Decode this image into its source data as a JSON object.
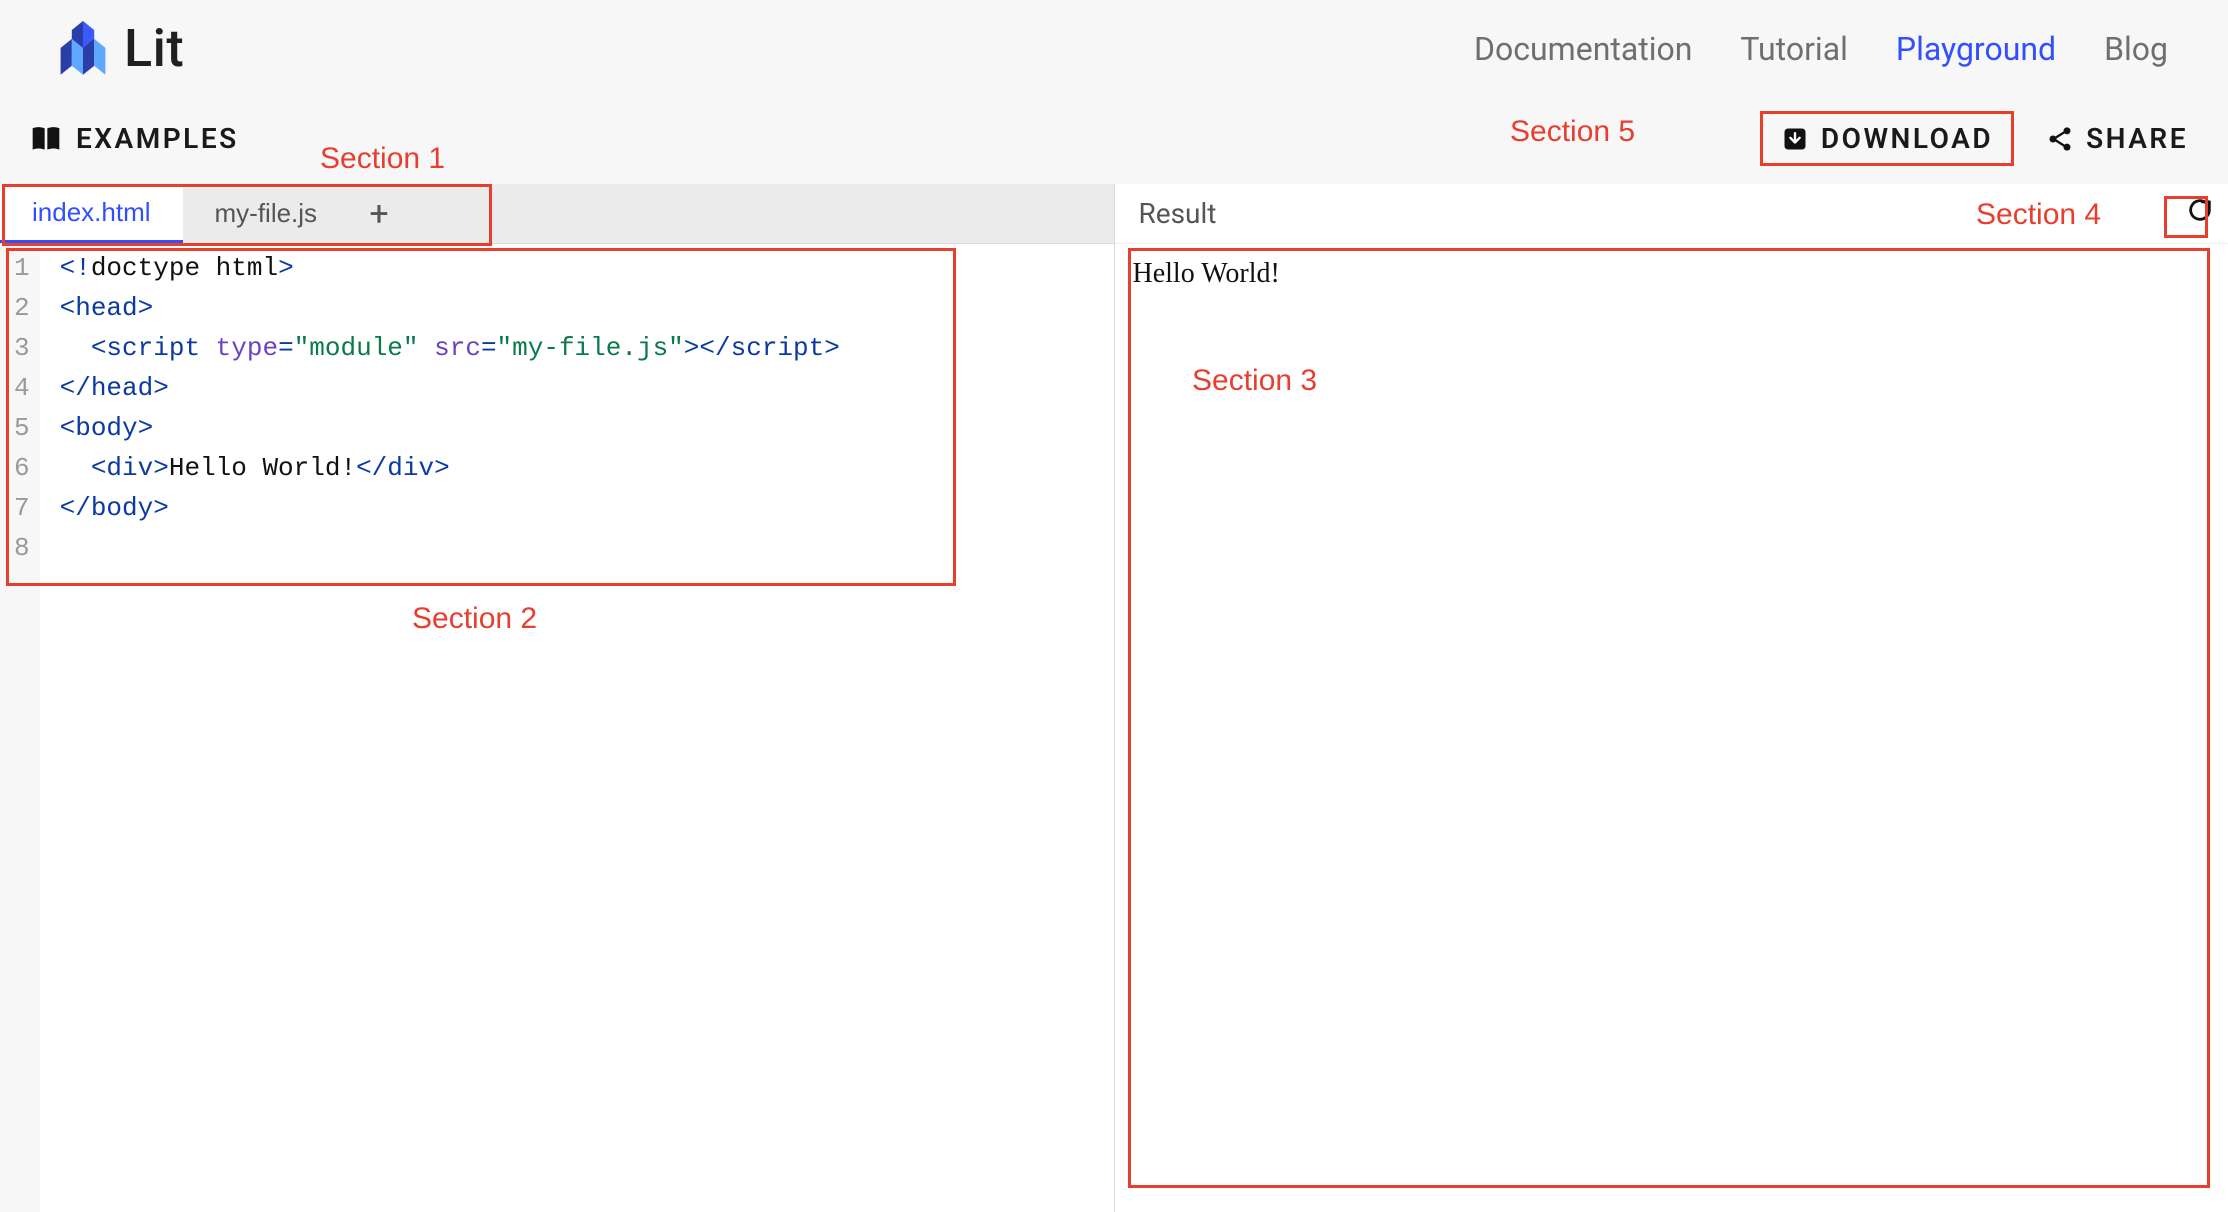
{
  "brand": {
    "name": "Lit"
  },
  "nav": {
    "items": [
      {
        "label": "Documentation",
        "active": false
      },
      {
        "label": "Tutorial",
        "active": false
      },
      {
        "label": "Playground",
        "active": true
      },
      {
        "label": "Blog",
        "active": false
      }
    ]
  },
  "toolbar": {
    "examples_label": "EXAMPLES",
    "download_label": "DOWNLOAD",
    "share_label": "SHARE"
  },
  "annotations": {
    "section1": "Section 1",
    "section2": "Section 2",
    "section3": "Section 3",
    "section4": "Section 4",
    "section5": "Section 5"
  },
  "editor": {
    "tabs": [
      {
        "label": "index.html",
        "active": true
      },
      {
        "label": "my-file.js",
        "active": false
      }
    ],
    "add_tab_glyph": "+",
    "line_count": 8,
    "code_lines": [
      {
        "n": 1,
        "tokens": [
          {
            "t": "<!",
            "c": "tag"
          },
          {
            "t": "doctype html",
            "c": "doctype"
          },
          {
            "t": ">",
            "c": "tag"
          }
        ]
      },
      {
        "n": 2,
        "tokens": [
          {
            "t": "<head>",
            "c": "tag"
          }
        ]
      },
      {
        "n": 3,
        "tokens": [
          {
            "t": "  ",
            "c": "txt"
          },
          {
            "t": "<script ",
            "c": "tag"
          },
          {
            "t": "type",
            "c": "attr"
          },
          {
            "t": "=",
            "c": "tag"
          },
          {
            "t": "\"module\"",
            "c": "str"
          },
          {
            "t": " ",
            "c": "txt"
          },
          {
            "t": "src",
            "c": "attr"
          },
          {
            "t": "=",
            "c": "tag"
          },
          {
            "t": "\"my-file.js\"",
            "c": "str"
          },
          {
            "t": ">",
            "c": "tag"
          },
          {
            "t": "</",
            "c": "tag"
          },
          {
            "t": "script",
            "c": "tag"
          },
          {
            "t": ">",
            "c": "tag"
          }
        ]
      },
      {
        "n": 4,
        "tokens": [
          {
            "t": "</head>",
            "c": "tag"
          }
        ]
      },
      {
        "n": 5,
        "tokens": [
          {
            "t": "<body>",
            "c": "tag"
          }
        ]
      },
      {
        "n": 6,
        "tokens": [
          {
            "t": "  ",
            "c": "txt"
          },
          {
            "t": "<div>",
            "c": "tag"
          },
          {
            "t": "Hello World!",
            "c": "txt"
          },
          {
            "t": "</div>",
            "c": "tag"
          }
        ]
      },
      {
        "n": 7,
        "tokens": [
          {
            "t": "</body>",
            "c": "tag"
          }
        ]
      },
      {
        "n": 8,
        "tokens": []
      }
    ]
  },
  "result": {
    "title": "Result",
    "output": "Hello World!"
  }
}
